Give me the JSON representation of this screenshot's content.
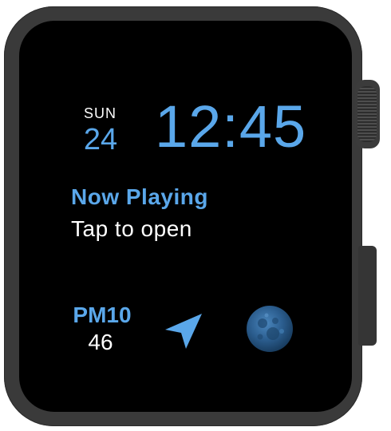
{
  "complications": {
    "date": {
      "day_name": "SUN",
      "day_number": "24"
    },
    "time": "12:45",
    "now_playing": {
      "title": "Now Playing",
      "subtitle": "Tap to open"
    },
    "air_quality": {
      "label": "PM10",
      "value": "46"
    },
    "icons": {
      "location": "location-arrow-icon",
      "moon": "moon-phase-icon"
    }
  },
  "colors": {
    "accent": "#5aa7ea",
    "screen_background": "#000000",
    "case": "#3a3a3a",
    "text_primary": "#ffffff"
  }
}
